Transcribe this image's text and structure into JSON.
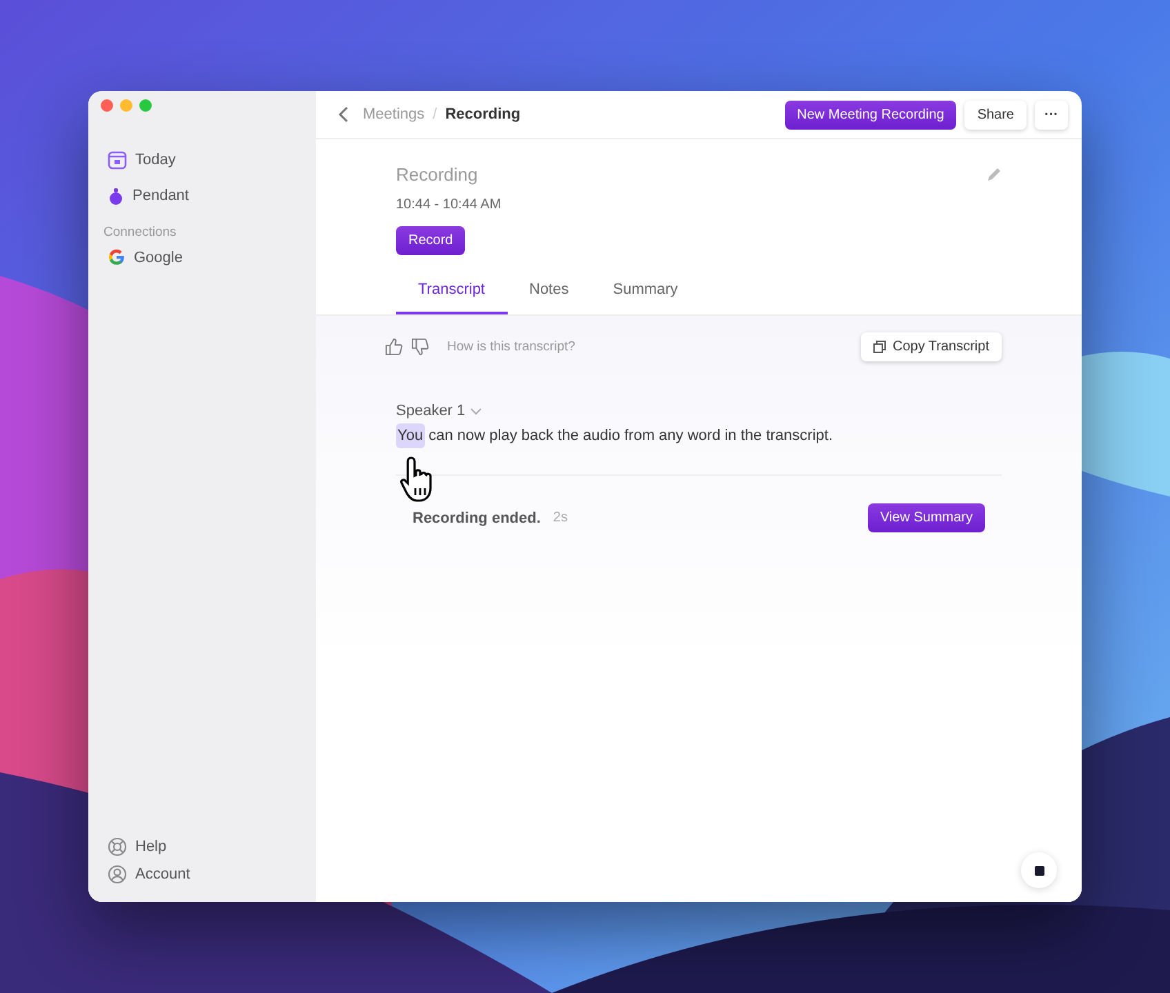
{
  "sidebar": {
    "items": [
      {
        "label": "Today",
        "kind": "calendar"
      },
      {
        "label": "Pendant",
        "kind": "pendant"
      }
    ],
    "connections_heading": "Connections",
    "connections": [
      {
        "label": "Google",
        "kind": "google"
      }
    ],
    "footer_items": [
      {
        "label": "Help",
        "kind": "help"
      },
      {
        "label": "Account",
        "kind": "account"
      }
    ]
  },
  "toolbar": {
    "breadcrumb": [
      "Meetings",
      "Recording"
    ],
    "separator": "/",
    "new_button": "New Meeting Recording",
    "share_button": "Share",
    "more_button": "···"
  },
  "header": {
    "title": "Recording",
    "time": "10:44 - 10:44 AM",
    "record_button": "Record"
  },
  "tabs": [
    {
      "label": "Transcript",
      "selected": true
    },
    {
      "label": "Notes",
      "selected": false
    },
    {
      "label": "Summary",
      "selected": false
    }
  ],
  "feedback": {
    "prompt": "How is this transcript?",
    "copy_button": "Copy Transcript"
  },
  "transcript": [
    {
      "speaker": "Speaker 1",
      "segments": [
        {
          "text": "You",
          "highlighted": true
        },
        {
          "text": " can now play back the audio from any word in the transcript.",
          "highlighted": false
        }
      ]
    }
  ],
  "status": {
    "message": "Recording ended.",
    "elapsed": "2s",
    "button": "View Summary"
  }
}
